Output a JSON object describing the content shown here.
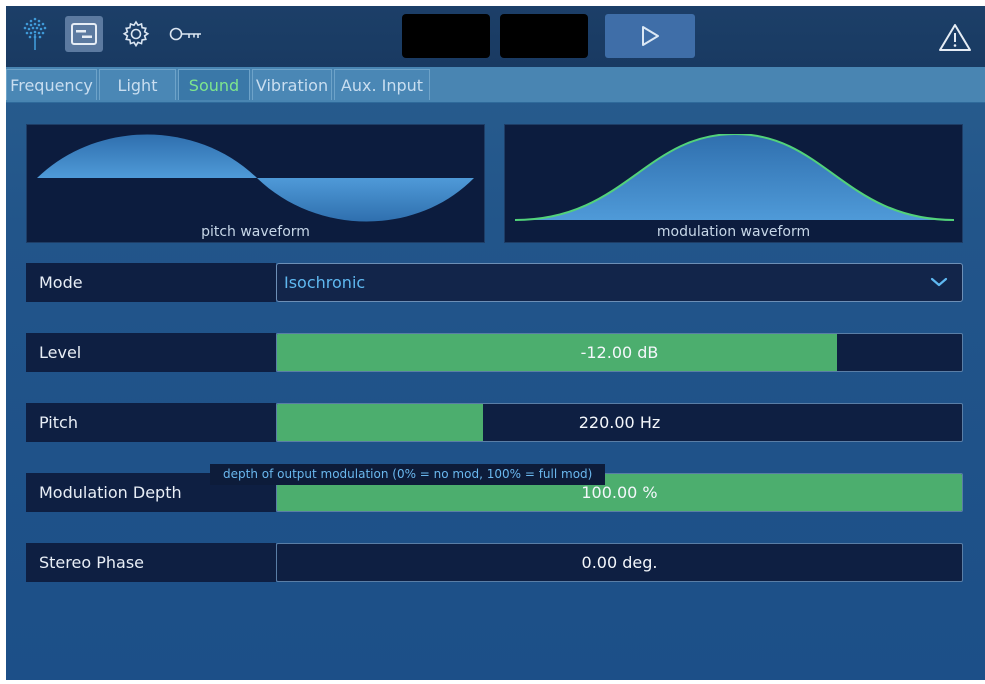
{
  "toolbar": {
    "icons": [
      "tree-logo-icon",
      "panel-toggle-icon",
      "gear-icon",
      "key-icon",
      "play-icon",
      "warning-icon"
    ]
  },
  "tabs": [
    {
      "label": "Frequency",
      "active": false
    },
    {
      "label": "Light",
      "active": false
    },
    {
      "label": "Sound",
      "active": true
    },
    {
      "label": "Vibration",
      "active": false
    },
    {
      "label": "Aux. Input",
      "active": false
    }
  ],
  "waveforms": {
    "pitch_label": "pitch waveform",
    "modulation_label": "modulation waveform"
  },
  "controls": {
    "mode": {
      "label": "Mode",
      "value": "Isochronic"
    },
    "level": {
      "label": "Level",
      "value": "-12.00 dB",
      "fill_fraction": 0.817
    },
    "pitch": {
      "label": "Pitch",
      "value": "220.00 Hz",
      "fill_fraction": 0.3
    },
    "modulation_depth": {
      "label": "Modulation Depth",
      "value": "100.00 %",
      "fill_fraction": 1.0
    },
    "stereo_phase": {
      "label": "Stereo Phase",
      "value": "0.00 deg.",
      "fill_fraction": 0.0
    }
  },
  "tooltip": "depth of output modulation (0% = no mod, 100% = full mod)",
  "colors": {
    "accent_green": "#4cae6e",
    "active_tab_text": "#7de58e",
    "mode_text": "#5fb8f0",
    "panel_bg": "#0e1f42"
  }
}
